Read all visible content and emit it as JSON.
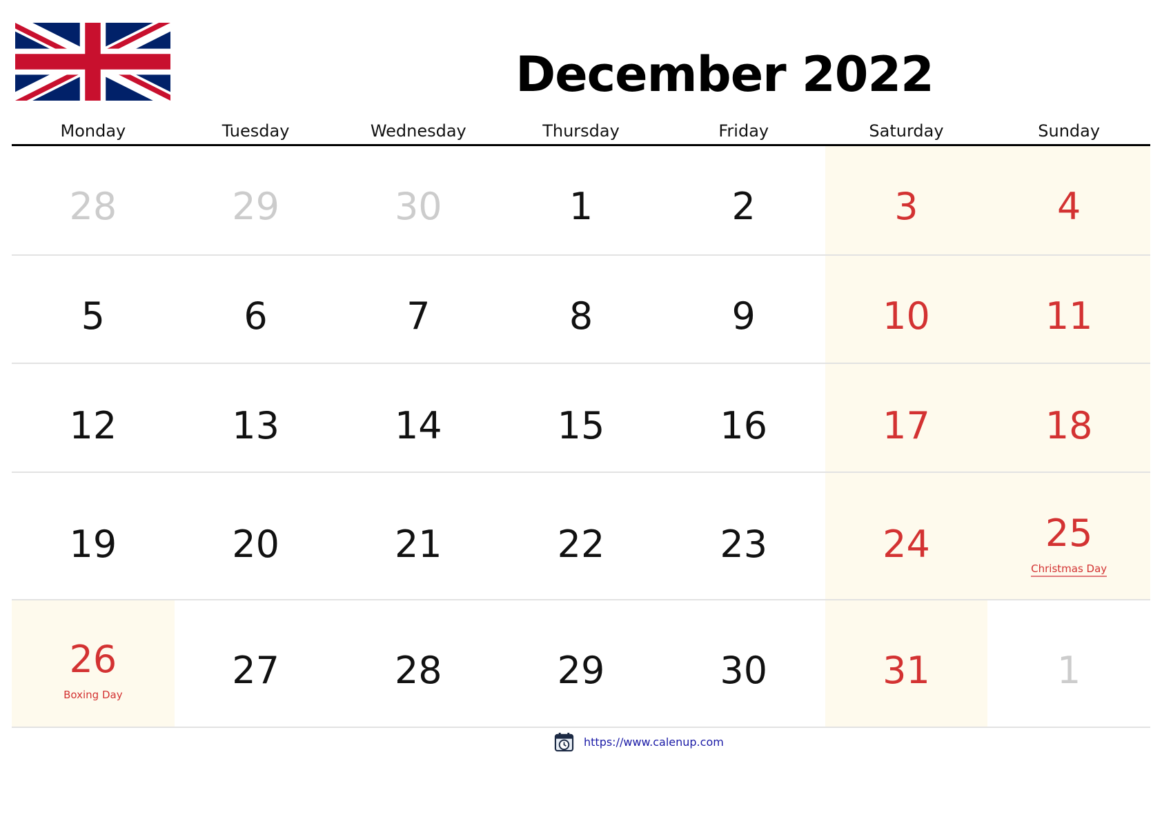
{
  "header": {
    "title": "December 2022",
    "flag_icon": "uk-flag-icon"
  },
  "weekdays": [
    "Monday",
    "Tuesday",
    "Wednesday",
    "Thursday",
    "Friday",
    "Saturday",
    "Sunday"
  ],
  "colors": {
    "weekend_text": "#d33232",
    "weekend_background": "#fefaed",
    "outside_month_text": "#cccccc",
    "normal_text": "#111111",
    "link": "#1a1aa6"
  },
  "weeks": [
    [
      {
        "day": "28",
        "type": "muted"
      },
      {
        "day": "29",
        "type": "muted"
      },
      {
        "day": "30",
        "type": "muted"
      },
      {
        "day": "1",
        "type": "normal"
      },
      {
        "day": "2",
        "type": "normal"
      },
      {
        "day": "3",
        "type": "weekend"
      },
      {
        "day": "4",
        "type": "weekend"
      }
    ],
    [
      {
        "day": "5",
        "type": "normal"
      },
      {
        "day": "6",
        "type": "normal"
      },
      {
        "day": "7",
        "type": "normal"
      },
      {
        "day": "8",
        "type": "normal"
      },
      {
        "day": "9",
        "type": "normal"
      },
      {
        "day": "10",
        "type": "weekend"
      },
      {
        "day": "11",
        "type": "weekend"
      }
    ],
    [
      {
        "day": "12",
        "type": "normal"
      },
      {
        "day": "13",
        "type": "normal"
      },
      {
        "day": "14",
        "type": "normal"
      },
      {
        "day": "15",
        "type": "normal"
      },
      {
        "day": "16",
        "type": "normal"
      },
      {
        "day": "17",
        "type": "weekend"
      },
      {
        "day": "18",
        "type": "weekend"
      }
    ],
    [
      {
        "day": "19",
        "type": "normal"
      },
      {
        "day": "20",
        "type": "normal"
      },
      {
        "day": "21",
        "type": "normal"
      },
      {
        "day": "22",
        "type": "normal"
      },
      {
        "day": "23",
        "type": "normal"
      },
      {
        "day": "24",
        "type": "weekend"
      },
      {
        "day": "25",
        "type": "weekend",
        "holiday": "Christmas Day",
        "underline": true
      }
    ],
    [
      {
        "day": "26",
        "type": "holiday",
        "holiday": "Boxing Day",
        "underline": false
      },
      {
        "day": "27",
        "type": "normal"
      },
      {
        "day": "28",
        "type": "normal"
      },
      {
        "day": "29",
        "type": "normal"
      },
      {
        "day": "30",
        "type": "normal"
      },
      {
        "day": "31",
        "type": "weekend"
      },
      {
        "day": "1",
        "type": "muted-plain"
      }
    ]
  ],
  "footer": {
    "icon": "calendar-clock-icon",
    "url_text": "https://www.calenup.com"
  }
}
